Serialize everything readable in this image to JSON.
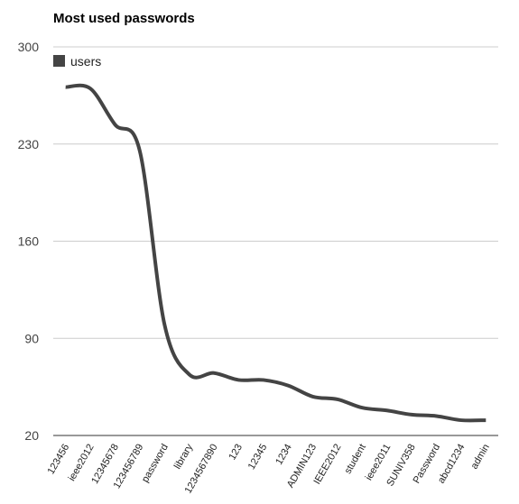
{
  "chart_data": {
    "type": "line",
    "title": "Most used passwords",
    "xlabel": "",
    "ylabel": "",
    "ylim": [
      20,
      300
    ],
    "yticks": [
      20,
      90,
      160,
      230,
      300
    ],
    "grid": true,
    "legend": "top-left",
    "smooth": true,
    "categories": [
      "123456",
      "ieee2012",
      "12345678",
      "123456789",
      "password",
      "library",
      "1234567890",
      "123",
      "12345",
      "1234",
      "ADMIN123",
      "IEEE2012",
      "student",
      "ieee2011",
      "SUNIV358",
      "Password",
      "abcd1234",
      "admin"
    ],
    "series": [
      {
        "name": "users",
        "color": "#444444",
        "values": [
          271,
          270,
          244,
          225,
          100,
          64,
          65,
          60,
          60,
          56,
          48,
          46,
          40,
          38,
          35,
          34,
          31,
          31
        ]
      }
    ]
  }
}
